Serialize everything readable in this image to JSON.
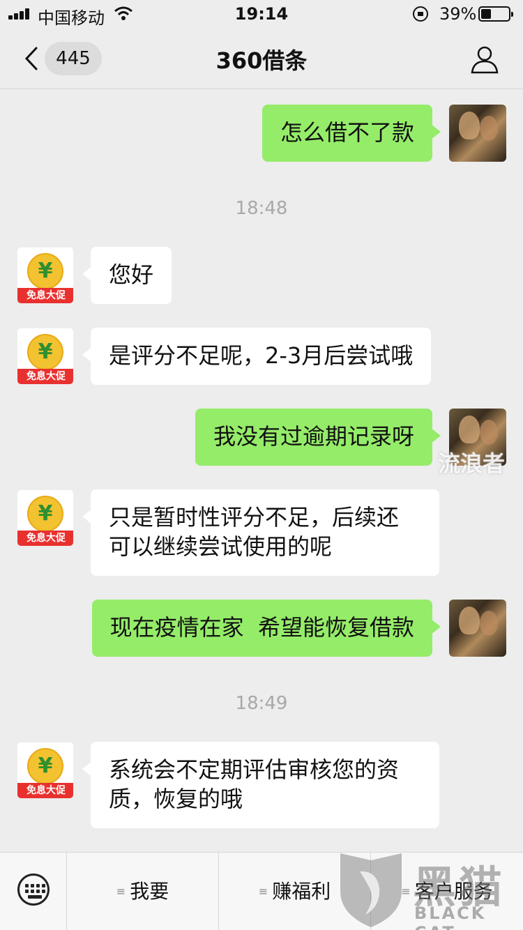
{
  "status_bar": {
    "carrier": "中国移动",
    "time": "19:14",
    "battery_percent": "39%"
  },
  "nav": {
    "unread_count": "445",
    "title": "360借条"
  },
  "bot": {
    "avatar_symbol": "¥",
    "avatar_label": "免息大促"
  },
  "messages": [
    {
      "side": "out",
      "text": "怎么借不了款"
    },
    {
      "type": "timestamp",
      "text": "18:48"
    },
    {
      "side": "in",
      "text": "您好"
    },
    {
      "side": "in",
      "text": "是评分不足呢，2-3月后尝试哦"
    },
    {
      "side": "out",
      "text": "我没有过逾期记录呀"
    },
    {
      "side": "in",
      "lines": [
        "只是暂时性评分不足，后续还",
        "可以继续尝试使用的呢"
      ]
    },
    {
      "side": "out",
      "text": "现在疫情在家  希望能恢复借款"
    },
    {
      "type": "timestamp",
      "text": "18:49"
    },
    {
      "side": "in",
      "lines": [
        "系统会不定期评估审核您的资",
        "质，恢复的哦"
      ]
    }
  ],
  "avatar_watermark": "流浪者",
  "menu": [
    "我要",
    "赚福利",
    "客户服务"
  ],
  "logo": {
    "cn": "黑猫",
    "en": "BLACK CAT"
  }
}
